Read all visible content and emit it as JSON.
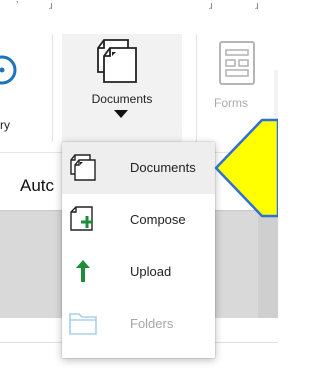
{
  "ribbon": {
    "top_fragment_1": "ʼ",
    "top_fragment_2": "ɹ",
    "top_fragment_3": "ɹ",
    "top_fragment_4": "ɹ",
    "buttons": {
      "history": {
        "label": "ry",
        "icon": "history-clock-icon"
      },
      "documents": {
        "label": "Documents",
        "icon": "documents-stack-icon"
      },
      "forms": {
        "label": "Forms",
        "icon": "forms-icon"
      }
    }
  },
  "subbar": {
    "left_text": "Autc",
    "right_text": "l"
  },
  "dropdown": {
    "items": [
      {
        "label": "Documents",
        "icon": "documents-stack-icon",
        "state": "selected"
      },
      {
        "label": "Compose",
        "icon": "compose-plus-icon",
        "state": "enabled"
      },
      {
        "label": "Upload",
        "icon": "upload-arrow-icon",
        "state": "enabled"
      },
      {
        "label": "Folders",
        "icon": "folder-icon",
        "state": "disabled"
      }
    ]
  },
  "colors": {
    "accent_blue": "#1e73be",
    "compose_green": "#1e8c3a",
    "upload_green": "#1e8c3a",
    "disabled_icon": "#a8d0ee",
    "annotation_fill": "#ffff00",
    "annotation_stroke": "#2f6fd6"
  }
}
